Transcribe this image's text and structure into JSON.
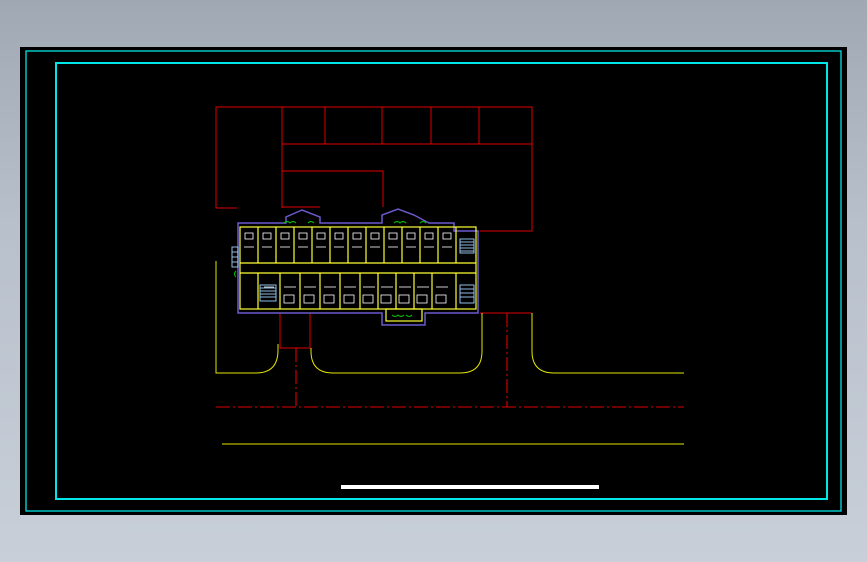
{
  "drawing": {
    "background": "#000000",
    "colors": {
      "frame": "#00e5e5",
      "site_boundary": "#e00000",
      "road_edge": "#e6e600",
      "centerline": "#e00000",
      "building_outline": "#6a5acd",
      "walls": "#ffff33",
      "fixtures": "#ffffff",
      "stairs": "#9fd3ff",
      "green": "#00d000",
      "title_bar": "#ffffff"
    }
  }
}
